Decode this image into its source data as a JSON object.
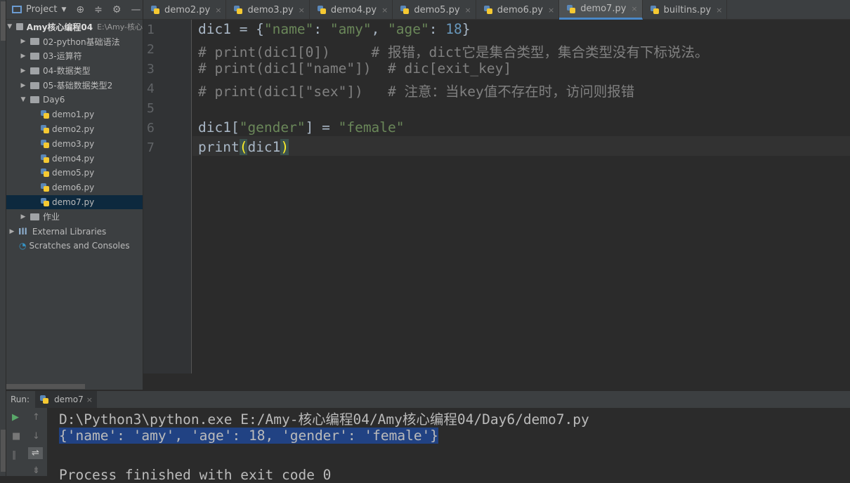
{
  "sidebar": {
    "title": "Project",
    "root": {
      "name": "Amy核心编程04",
      "path": "E:\\Amy-核心"
    },
    "items": [
      {
        "label": "02-python基础语法",
        "type": "folder",
        "level": 1,
        "expanded": false
      },
      {
        "label": "03-运算符",
        "type": "folder",
        "level": 1,
        "expanded": false
      },
      {
        "label": "04-数据类型",
        "type": "folder",
        "level": 1,
        "expanded": false
      },
      {
        "label": "05-基础数据类型2",
        "type": "folder",
        "level": 1,
        "expanded": false
      },
      {
        "label": "Day6",
        "type": "folder",
        "level": 1,
        "expanded": true
      },
      {
        "label": "demo1.py",
        "type": "py",
        "level": 2
      },
      {
        "label": "demo2.py",
        "type": "py",
        "level": 2
      },
      {
        "label": "demo3.py",
        "type": "py",
        "level": 2
      },
      {
        "label": "demo4.py",
        "type": "py",
        "level": 2
      },
      {
        "label": "demo5.py",
        "type": "py",
        "level": 2
      },
      {
        "label": "demo6.py",
        "type": "py",
        "level": 2
      },
      {
        "label": "demo7.py",
        "type": "py",
        "level": 2,
        "selected": true
      },
      {
        "label": "作业",
        "type": "folder",
        "level": 1,
        "expanded": false
      },
      {
        "label": "External Libraries",
        "type": "lib",
        "level": 0,
        "expanded": false
      },
      {
        "label": "Scratches and Consoles",
        "type": "scratch",
        "level": 0
      }
    ]
  },
  "tabs": [
    {
      "label": "demo2.py"
    },
    {
      "label": "demo3.py"
    },
    {
      "label": "demo4.py"
    },
    {
      "label": "demo5.py"
    },
    {
      "label": "demo6.py"
    },
    {
      "label": "demo7.py",
      "active": true
    },
    {
      "label": "builtins.py"
    }
  ],
  "code": [
    [
      [
        "p",
        "dic1 = {"
      ],
      [
        "s",
        "\"name\""
      ],
      [
        "p",
        ": "
      ],
      [
        "s",
        "\"amy\""
      ],
      [
        "p",
        ", "
      ],
      [
        "s",
        "\"age\""
      ],
      [
        "p",
        ": "
      ],
      [
        "n",
        "18"
      ],
      [
        "p",
        "}"
      ]
    ],
    [
      [
        "c",
        "# print(dic1[0])     # 报错，dict它是集合类型，集合类型没有下标说法。"
      ]
    ],
    [
      [
        "c",
        "# print(dic1[\"name\"])  # dic[exit_key]"
      ]
    ],
    [
      [
        "c",
        "# print(dic1[\"sex\"])   # 注意：当key值不存在时，访问则报错"
      ]
    ],
    [],
    [
      [
        "p",
        "dic1["
      ],
      [
        "s",
        "\"gender\""
      ],
      [
        "p",
        "] = "
      ],
      [
        "s",
        "\"female\""
      ]
    ],
    [
      [
        "p",
        "print"
      ],
      [
        "b",
        "("
      ],
      [
        "p",
        "dic1"
      ],
      [
        "b",
        ")"
      ]
    ]
  ],
  "run": {
    "label": "Run:",
    "tab": "demo7",
    "output": [
      "D:\\Python3\\python.exe E:/Amy-核心编程04/Amy核心编程04/Day6/demo7.py",
      "{'name': 'amy', 'age': 18, 'gender': 'female'}",
      "",
      "Process finished with exit code 0"
    ]
  },
  "colors": {
    "string": "#6a8759",
    "number": "#6897bb",
    "comment": "#808080",
    "selection": "#214283",
    "accent": "#4a88c7"
  }
}
